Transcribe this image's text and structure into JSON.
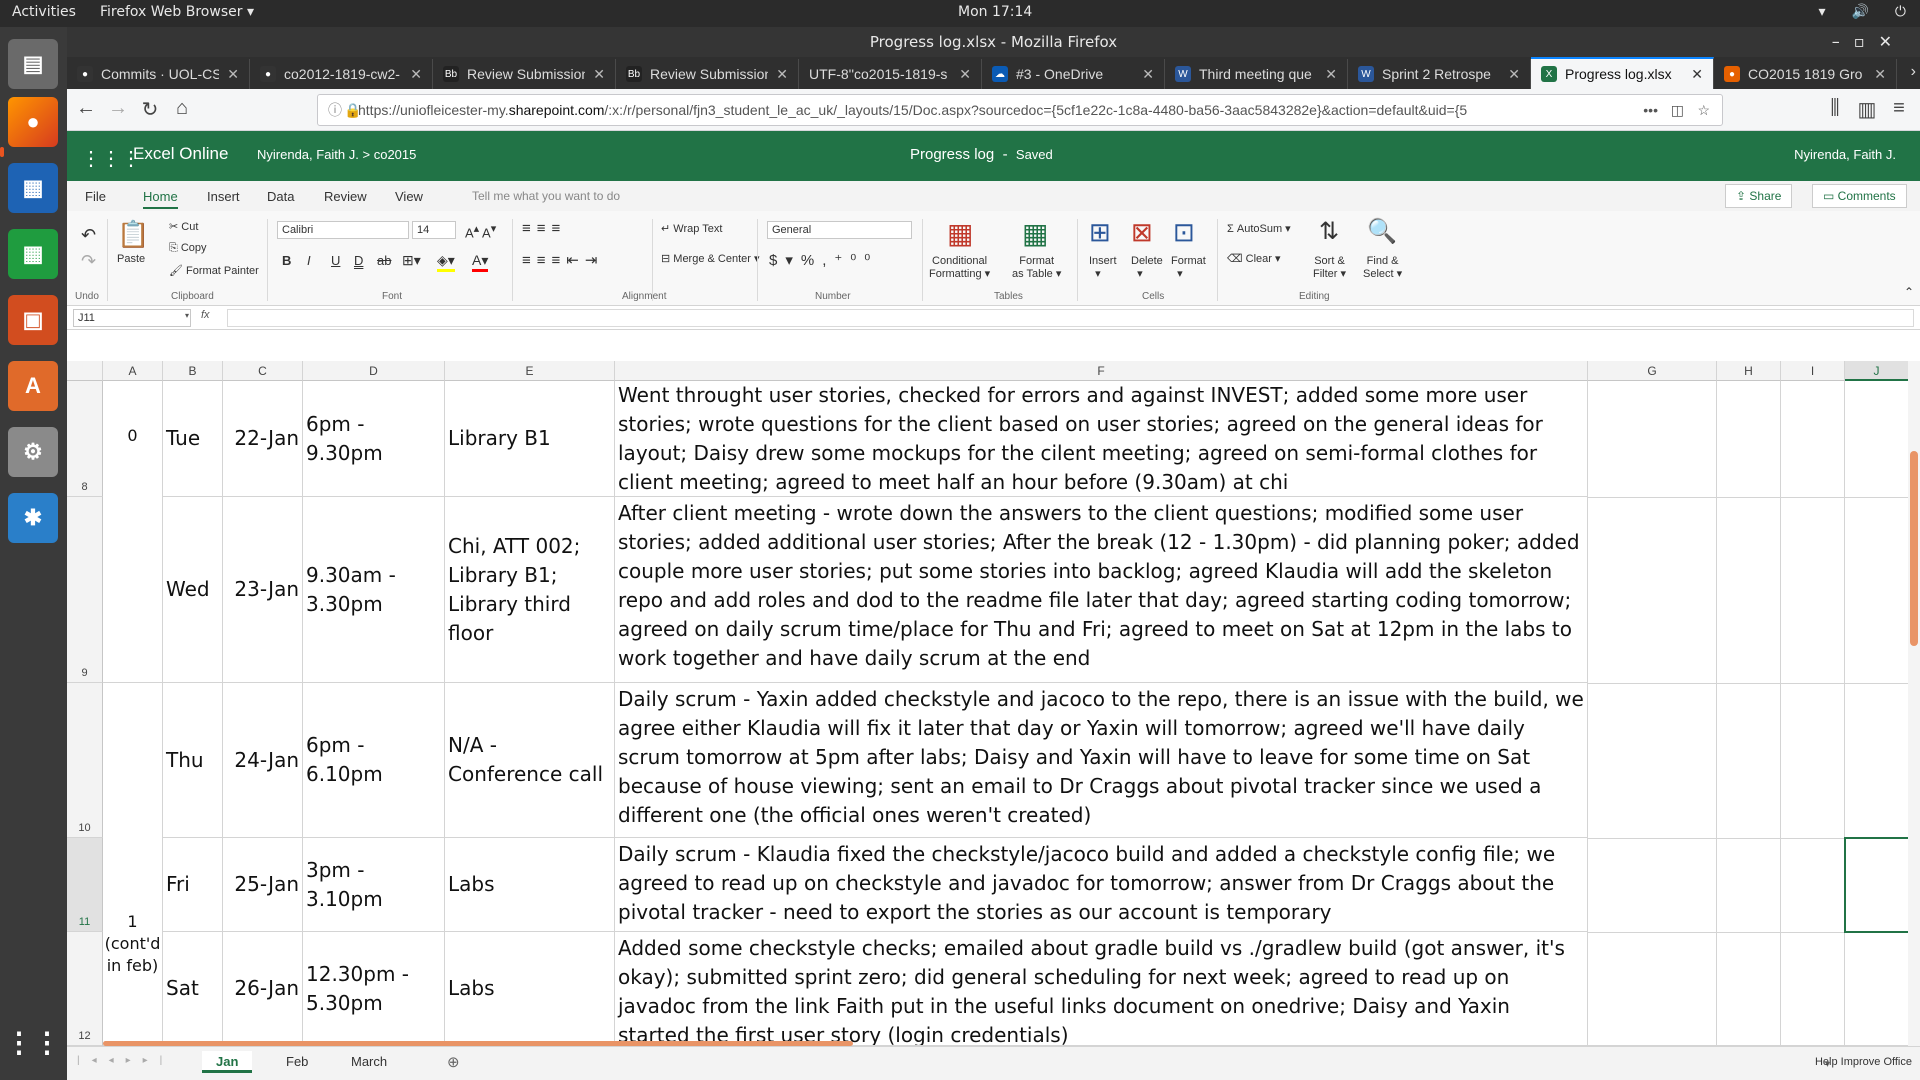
{
  "topbar": {
    "activities": "Activities",
    "app_menu": "Firefox Web Browser ▾",
    "clock": "Mon 17:14",
    "tray_icons": [
      "network-icon",
      "volume-icon",
      "power-icon"
    ]
  },
  "window": {
    "title": "Progress log.xlsx - Mozilla Firefox"
  },
  "tabs": [
    {
      "title": "Commits · UOL-CS",
      "favicon": "github-icon"
    },
    {
      "title": "co2012-1819-cw2-",
      "favicon": "github-icon"
    },
    {
      "title": "Review Submission",
      "favicon": "blackboard-icon"
    },
    {
      "title": "Review Submission",
      "favicon": "blackboard-icon"
    },
    {
      "title": "UTF-8''co2015-1819-s",
      "favicon": "file-icon"
    },
    {
      "title": "#3 - OneDrive",
      "favicon": "onedrive-icon"
    },
    {
      "title": "Third meeting que",
      "favicon": "word-icon"
    },
    {
      "title": "Sprint 2 Retrospe",
      "favicon": "word-icon"
    },
    {
      "title": "Progress log.xlsx",
      "favicon": "excel-icon",
      "active": true
    },
    {
      "title": "CO2015 1819 Gro",
      "favicon": "firefox-icon"
    }
  ],
  "url": {
    "prefix": "https://uniofleicester-my.",
    "host": "sharepoint.com",
    "rest": "/:x:/r/personal/fjn3_student_le_ac_uk/_layouts/15/Doc.aspx?sourcedoc={5cf1e22c-1c8a-4480-ba56-3aac5843282e}&action=default&uid={5"
  },
  "excel": {
    "app_name": "Excel Online",
    "owner": "Nyirenda, Faith J.",
    "crumb_sep": ">",
    "folder": "co2015",
    "doc_title": "Progress log",
    "doc_sep": "-",
    "save_status": "Saved",
    "user": "Nyirenda, Faith J.",
    "menu": [
      "File",
      "Home",
      "Insert",
      "Data",
      "Review",
      "View"
    ],
    "active_menu": "Home",
    "tell_me": "Tell me what you want to do",
    "share": "Share",
    "comments": "Comments"
  },
  "ribbon": {
    "undo_group": "Undo",
    "paste": "Paste",
    "cut": "Cut",
    "copy": "Copy",
    "format_painter": "Format Painter",
    "clipboard_group": "Clipboard",
    "font_name": "Calibri",
    "font_size": "14",
    "font_group": "Font",
    "wrap_text": "Wrap Text",
    "merge_center": "Merge & Center",
    "alignment_group": "Alignment",
    "number_format": "General",
    "number_group": "Number",
    "conditional_formatting_1": "Conditional",
    "conditional_formatting_2": "Formatting",
    "format_table_1": "Format",
    "format_table_2": "as Table",
    "tables_group": "Tables",
    "insert": "Insert",
    "delete": "Delete",
    "format": "Format",
    "cells_group": "Cells",
    "autosum": "AutoSum",
    "clear": "Clear",
    "sort_filter_1": "Sort &",
    "sort_filter_2": "Filter",
    "find_select_1": "Find &",
    "find_select_2": "Select",
    "editing_group": "Editing"
  },
  "formula_bar": {
    "name_box": "J11",
    "fx": "fx",
    "value": ""
  },
  "columns": [
    "A",
    "B",
    "C",
    "D",
    "E",
    "F",
    "G",
    "H",
    "I",
    "J"
  ],
  "selected_column": "J",
  "rows": [
    {
      "num": "8",
      "day": "Tue",
      "date": "22-Jan",
      "time": "6pm - 9.30pm",
      "location": "Library B1",
      "notes": "Went throught user stories, checked for errors and against INVEST; added some more user stories; wrote questions for the client based on user stories; agreed on the general ideas for layout; Daisy drew some mockups for the cilent meeting; agreed on semi-formal clothes for client meeting; agreed to meet half an hour before (9.30am) at chi"
    },
    {
      "num": "9",
      "day": "Wed",
      "date": "23-Jan",
      "time": "9.30am - 3.30pm",
      "location": "Chi, ATT 002; Library B1; Library third floor",
      "notes": "After client meeting - wrote down the answers to the client questions; modified some user stories; added additional user stories; After the break (12 - 1.30pm) - did planning poker; added couple more user stories; put some stories into backlog; agreed Klaudia will add the skeleton repo and add roles and dod to the readme file later that day; agreed starting coding tomorrow; agreed on daily scrum time/place for Thu and Fri; agreed to meet on Sat at 12pm in the labs to work together and have daily scrum at the end"
    },
    {
      "num": "10",
      "day": "Thu",
      "date": "24-Jan",
      "time": "6pm - 6.10pm",
      "location": "N/A - Conference call",
      "notes": "Daily scrum - Yaxin added checkstyle and jacoco to the repo, there is an issue with the build, we agree either Klaudia will fix it later that day or Yaxin will tomorrow; agreed we'll have daily scrum tomorrow at 5pm after labs; Daisy and Yaxin will have to leave for some time on Sat because of house viewing; sent an email to Dr Craggs about pivotal tracker since we used a different one (the official ones weren't created)"
    },
    {
      "num": "11",
      "day": "Fri",
      "date": "25-Jan",
      "time": "3pm - 3.10pm",
      "location": "Labs",
      "notes": "Daily scrum - Klaudia fixed the checkstyle/jacoco build and added a checkstyle config file; we agreed to read up on checkstyle and javadoc for tomorrow; answer from Dr Craggs about the pivotal tracker - need to export the stories as our account is temporary"
    },
    {
      "num": "12",
      "day": "Sat",
      "date": "26-Jan",
      "time": "12.30pm - 5.30pm",
      "location": "Labs",
      "notes": "Added some checkstyle checks; emailed about gradle build vs ./gradlew build (got answer, it's okay); submitted sprint zero; did general scheduling for next week; agreed to read up on javadoc from the link Faith put in the useful links document on onedrive; Daisy and Yaxin started the first user story (login credentials)"
    }
  ],
  "sprint_cells": {
    "sprint0": "0",
    "sprint1": "1 (cont'd in feb)"
  },
  "selected_cell": "J11",
  "sheets": [
    "Jan",
    "Feb",
    "March"
  ],
  "active_sheet": "Jan",
  "status_right": "Help Improve Office",
  "accent_color": "#217346"
}
